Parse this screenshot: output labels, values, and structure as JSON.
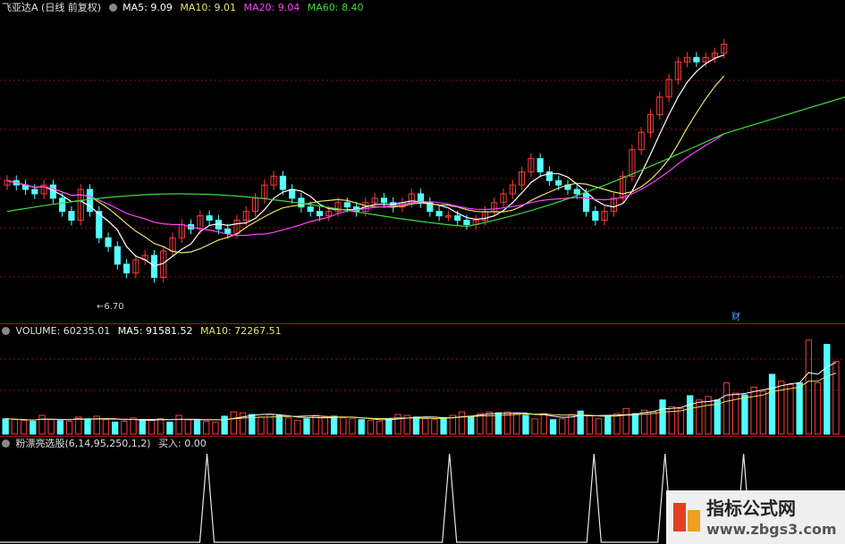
{
  "price_header": {
    "title": "飞亚达A (日线 前复权)",
    "ma5": "MA5: 9.09",
    "ma10": "MA10: 9.01",
    "ma20": "MA20: 9.04",
    "ma60": "MA60: 8.40"
  },
  "price_low_label": "←6.70",
  "finance_marker": "财",
  "volume_header": {
    "volume": "VOLUME: 60235.01",
    "ma5": "MA5: 91581.52",
    "ma10": "MA10: 72267.51"
  },
  "indicator_header": {
    "name": "粉漂亮选股(6,14,95,250,1,2)",
    "value": "买入: 0.00"
  },
  "watermark": {
    "title": "指标公式网",
    "url": "www.zbgs3.com"
  },
  "colors": {
    "up": "#ff3b3b",
    "down": "#54ffff",
    "ma5": "#ffffff",
    "ma10": "#e8e36a",
    "ma20": "#ff40ff",
    "ma60": "#3ddc3d",
    "grid": "#8b1010"
  },
  "chart_data": [
    {
      "type": "candlestick",
      "title": "飞亚达A (日线 前复权)",
      "series": [
        {
          "name": "MA5",
          "last": 9.09
        },
        {
          "name": "MA10",
          "last": 9.01
        },
        {
          "name": "MA20",
          "last": 9.04
        },
        {
          "name": "MA60",
          "last": 8.4
        }
      ],
      "annotations": [
        "←6.70",
        "财"
      ],
      "price_low": 6.7,
      "price_high": 9.6,
      "candles_close": [
        7.95,
        7.9,
        7.85,
        7.8,
        7.9,
        7.75,
        7.6,
        7.5,
        7.85,
        7.6,
        7.3,
        7.2,
        7.0,
        6.9,
        7.05,
        7.1,
        6.85,
        7.15,
        7.3,
        7.45,
        7.4,
        7.55,
        7.5,
        7.4,
        7.35,
        7.5,
        7.6,
        7.75,
        7.9,
        8.0,
        7.85,
        7.75,
        7.65,
        7.6,
        7.55,
        7.6,
        7.7,
        7.65,
        7.6,
        7.7,
        7.75,
        7.7,
        7.65,
        7.7,
        7.8,
        7.7,
        7.6,
        7.55,
        7.55,
        7.5,
        7.45,
        7.5,
        7.6,
        7.7,
        7.8,
        7.9,
        8.05,
        8.2,
        8.05,
        7.95,
        7.9,
        7.85,
        7.8,
        7.6,
        7.5,
        7.6,
        7.75,
        8.0,
        8.3,
        8.5,
        8.7,
        8.9,
        9.1,
        9.3,
        9.35,
        9.3,
        9.35,
        9.4,
        9.5
      ],
      "candles_open": [
        7.9,
        7.95,
        7.9,
        7.85,
        7.8,
        7.9,
        7.75,
        7.6,
        7.5,
        7.85,
        7.6,
        7.3,
        7.2,
        7.0,
        6.9,
        7.05,
        7.1,
        6.85,
        7.15,
        7.3,
        7.45,
        7.4,
        7.55,
        7.5,
        7.4,
        7.35,
        7.5,
        7.6,
        7.75,
        7.9,
        8.0,
        7.85,
        7.75,
        7.65,
        7.6,
        7.55,
        7.6,
        7.7,
        7.65,
        7.6,
        7.7,
        7.75,
        7.7,
        7.65,
        7.7,
        7.8,
        7.7,
        7.6,
        7.55,
        7.55,
        7.5,
        7.45,
        7.5,
        7.6,
        7.7,
        7.8,
        7.9,
        8.05,
        8.2,
        8.05,
        7.95,
        7.9,
        7.85,
        7.8,
        7.6,
        7.5,
        7.6,
        7.75,
        8.0,
        8.3,
        8.5,
        8.7,
        8.9,
        9.1,
        9.3,
        9.35,
        9.3,
        9.35,
        9.4
      ]
    },
    {
      "type": "bar",
      "title": "VOLUME",
      "series": [
        {
          "name": "VOLUME",
          "last": 60235.01
        },
        {
          "name": "MA5",
          "last": 91581.52
        },
        {
          "name": "MA10",
          "last": 72267.51
        }
      ],
      "values": [
        18,
        17,
        16,
        15,
        22,
        17,
        16,
        15,
        20,
        18,
        21,
        17,
        14,
        15,
        19,
        17,
        16,
        18,
        14,
        22,
        17,
        16,
        15,
        14,
        21,
        26,
        25,
        23,
        20,
        23,
        22,
        19,
        16,
        18,
        22,
        20,
        21,
        19,
        18,
        17,
        16,
        15,
        18,
        23,
        22,
        20,
        18,
        17,
        19,
        22,
        26,
        21,
        24,
        26,
        25,
        26,
        24,
        22,
        18,
        24,
        17,
        18,
        23,
        27,
        22,
        18,
        20,
        24,
        30,
        24,
        28,
        26,
        40,
        32,
        30,
        45,
        40,
        44,
        40,
        60,
        48,
        46,
        55,
        50,
        70,
        62,
        58,
        60,
        110,
        60,
        105,
        85
      ]
    },
    {
      "type": "line",
      "title": "粉漂亮选股(6,14,95,250,1,2)",
      "series": [
        {
          "name": "买入",
          "last": 0.0
        }
      ],
      "signal_positions": [
        0.245,
        0.532,
        0.703,
        0.787,
        0.88
      ]
    }
  ]
}
